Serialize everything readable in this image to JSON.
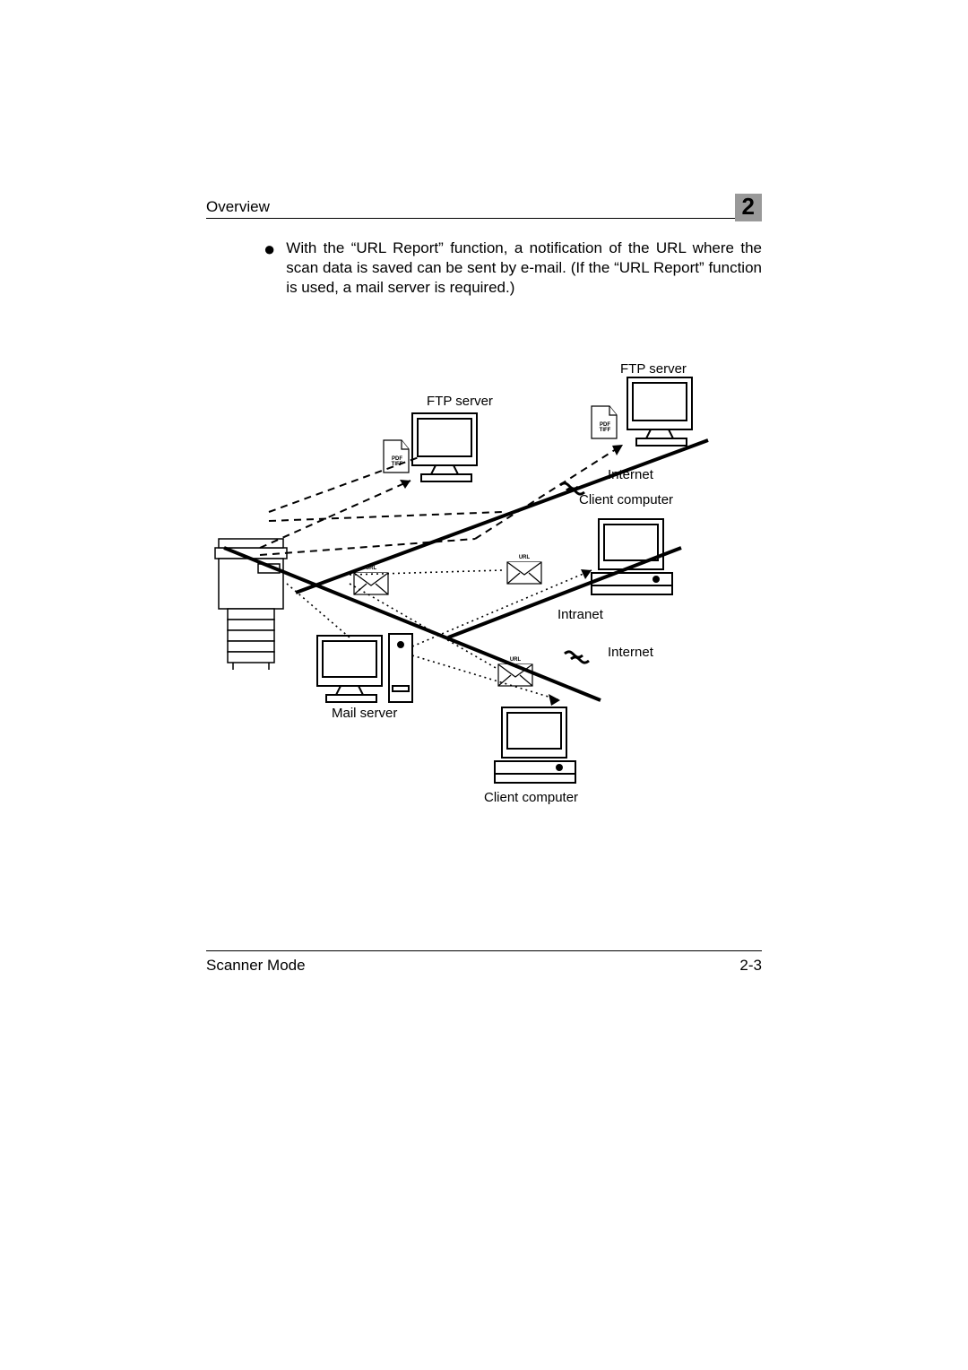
{
  "header": {
    "section": "Overview",
    "chapter": "2"
  },
  "body": {
    "bullet_text": "With the “URL Report” function, a notification of the URL where the scan data is saved can be sent by e-mail. (If the “URL Report” function is used, a mail server is required.)"
  },
  "diagram": {
    "labels": {
      "ftp_server_1": "FTP server",
      "ftp_server_2": "FTP server",
      "internet_1": "Internet",
      "internet_2": "Internet",
      "intranet": "Intranet",
      "client_1": "Client computer",
      "client_2": "Client computer",
      "mail_server": "Mail server"
    },
    "file_tag_1": "PDF\nTIFF",
    "file_tag_2": "PDF\nTIFF",
    "url_tag_1": "URL",
    "url_tag_2": "URL",
    "url_tag_3": "URL"
  },
  "footer": {
    "mode": "Scanner Mode",
    "page": "2-3"
  }
}
